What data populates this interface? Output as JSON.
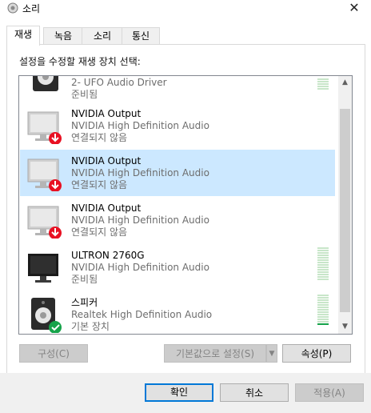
{
  "window": {
    "title": "소리",
    "close_glyph": "✕"
  },
  "tabs": [
    {
      "label": "재생",
      "active": true
    },
    {
      "label": "녹음",
      "active": false
    },
    {
      "label": "소리",
      "active": false
    },
    {
      "label": "통신",
      "active": false
    }
  ],
  "instruction": "설정을 수정할 재생 장치 선택:",
  "devices": [
    {
      "name": "2- UFO Audio Driver",
      "driver": "",
      "status": "준비됨",
      "icon": "speaker-icon",
      "selected": false,
      "level": 0.0
    },
    {
      "name": "NVIDIA Output",
      "driver": "NVIDIA High Definition Audio",
      "status": "연결되지 않음",
      "icon": "monitor-disconnected-icon",
      "selected": false
    },
    {
      "name": "NVIDIA Output",
      "driver": "NVIDIA High Definition Audio",
      "status": "연결되지 않음",
      "icon": "monitor-disconnected-icon",
      "selected": true
    },
    {
      "name": "NVIDIA Output",
      "driver": "NVIDIA High Definition Audio",
      "status": "연결되지 않음",
      "icon": "monitor-disconnected-icon",
      "selected": false
    },
    {
      "name": "ULTRON 2760G",
      "driver": "NVIDIA High Definition Audio",
      "status": "준비됨",
      "icon": "monitor-icon",
      "selected": false,
      "level": 0.0
    },
    {
      "name": "스피커",
      "driver": "Realtek High Definition Audio",
      "status": "기본 장치",
      "icon": "speaker-default-icon",
      "selected": false,
      "level": 0.1
    }
  ],
  "buttons": {
    "configure": "구성(C)",
    "set_default": "기본값으로 설정(S)",
    "properties": "속성(P)",
    "ok": "확인",
    "cancel": "취소",
    "apply": "적용(A)"
  },
  "colors": {
    "selection": "#cce8ff",
    "accent": "#0078d7",
    "disconnected": "#e81123",
    "default_check": "#16a34a"
  }
}
